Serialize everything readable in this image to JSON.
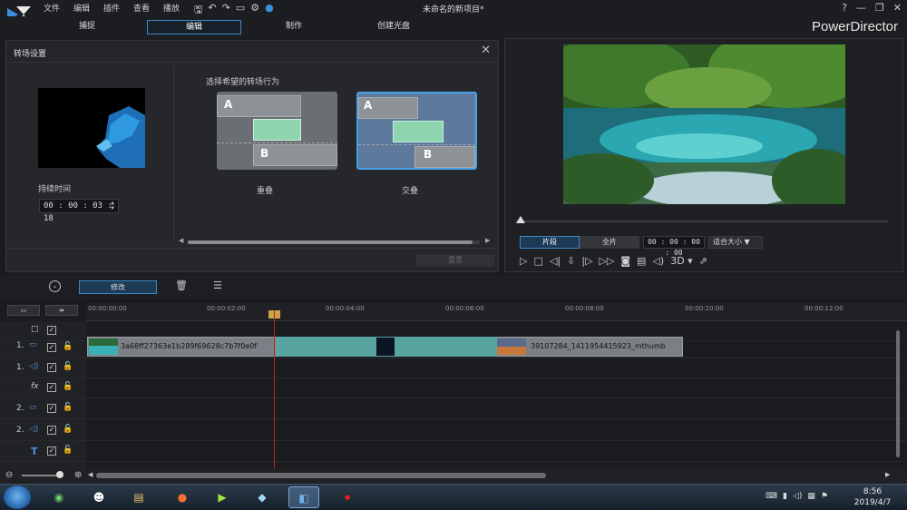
{
  "app": {
    "menu": [
      "文件",
      "编辑",
      "插件",
      "查看",
      "播放"
    ],
    "project_title": "未命名的新项目*",
    "brand": "PowerDirector",
    "win_controls": [
      "?",
      "—",
      "❐",
      "✕"
    ]
  },
  "tabs": [
    {
      "label": "捕捉",
      "active": false
    },
    {
      "label": "编辑",
      "active": true
    },
    {
      "label": "制作",
      "active": false
    },
    {
      "label": "创建光盘",
      "active": false
    }
  ],
  "transition_panel": {
    "title": "转场设置",
    "duration_label": "持续时间",
    "duration_value": "00 : 00 : 03 : 18",
    "prompt": "选择希望的转场行为",
    "options": [
      {
        "caption": "重叠",
        "label_a": "A",
        "label_b": "B",
        "selected": false
      },
      {
        "caption": "交叠",
        "label_a": "A",
        "label_b": "B",
        "selected": true
      }
    ],
    "apply_label": "重置"
  },
  "preview": {
    "segment_label": "片段",
    "full_label": "全片",
    "timecode": "00 : 00 : 00 : 00",
    "fit_label": "适合大小",
    "threed_label": "3D"
  },
  "toolbar": {
    "modify_label": "修改"
  },
  "timeline": {
    "ticks": [
      "00:00:00:00",
      "00:00:02:00",
      "00:00:04:00",
      "00:00:06:00",
      "00:00:08:00",
      "00:00:10:00",
      "00:00:12:00"
    ],
    "tracks": [
      {
        "num": "",
        "icon": "□"
      },
      {
        "num": "1.",
        "icon": "▭"
      },
      {
        "num": "1.",
        "icon": "◁)"
      },
      {
        "num": "",
        "icon": "fx"
      },
      {
        "num": "2.",
        "icon": "▭"
      },
      {
        "num": "2.",
        "icon": "◁)"
      },
      {
        "num": "",
        "icon": "T"
      }
    ],
    "clip1_name": "3a68ff27363e1b289f69628c7b7f0e0f",
    "clip2_name": "39107284_1411954415923_mthumb"
  },
  "taskbar": {
    "time": "8:56",
    "date": "2019/4/7"
  },
  "colors": {
    "accent": "#3c87c8",
    "overlap": "#58a4a0",
    "playhead": "#c02020"
  }
}
